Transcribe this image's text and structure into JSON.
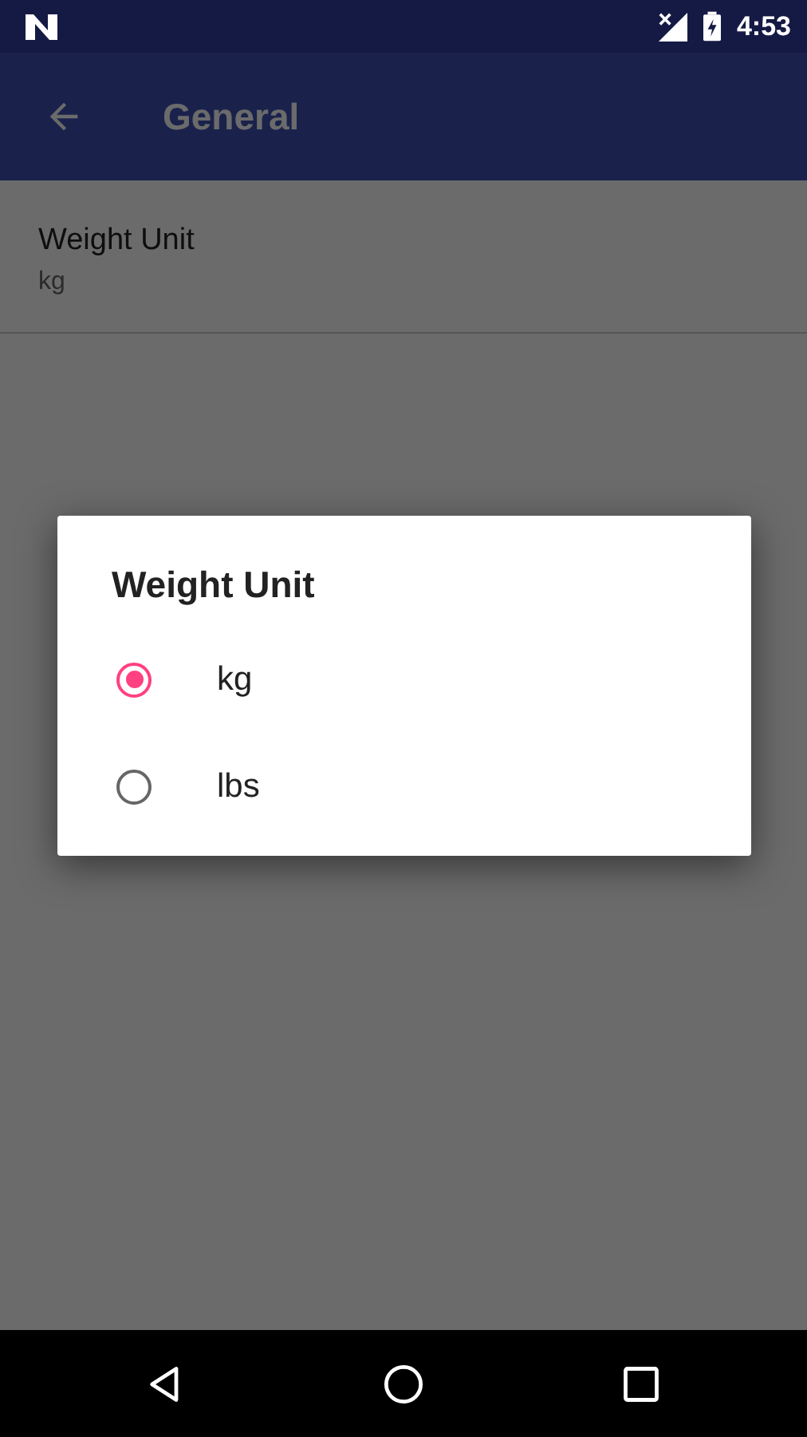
{
  "status_bar": {
    "time": "4:53"
  },
  "app_bar": {
    "title": "General"
  },
  "settings": [
    {
      "title": "Weight Unit",
      "summary": "kg"
    }
  ],
  "dialog": {
    "title": "Weight Unit",
    "options": [
      {
        "label": "kg",
        "selected": true
      },
      {
        "label": "lbs",
        "selected": false
      }
    ]
  }
}
